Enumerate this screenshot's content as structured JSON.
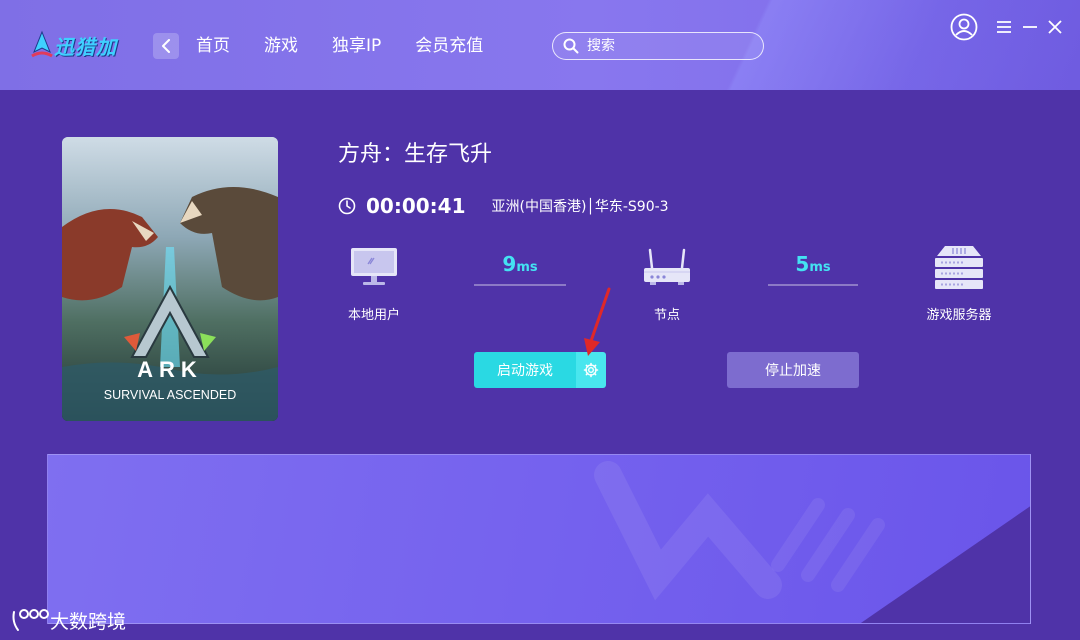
{
  "header": {
    "logo_text": "迅猎加",
    "nav": [
      "首页",
      "游戏",
      "独享IP",
      "会员充值"
    ],
    "search_placeholder": "搜索"
  },
  "game": {
    "title": "方舟：生存飞升",
    "cover_title": "ARK",
    "cover_subtitle": "SURVIVAL ASCENDED",
    "timer": "00:00:41",
    "region": "亚洲(中国香港)│华东-S90-3"
  },
  "route": {
    "local_label": "本地用户",
    "node_label": "节点",
    "server_label": "游戏服务器",
    "latency_local_node": "9",
    "latency_node_server": "5",
    "unit": "ms"
  },
  "actions": {
    "start_label": "启动游戏",
    "stop_label": "停止加速"
  },
  "watermark": {
    "text": "大数跨境"
  },
  "colors": {
    "background": "#4f33a8",
    "header": "#8877ee",
    "accent_cyan": "#2ad9e3",
    "latency_text": "#44e2f2",
    "stop_button": "#7d6ccf",
    "annotation_arrow": "#e02828"
  }
}
